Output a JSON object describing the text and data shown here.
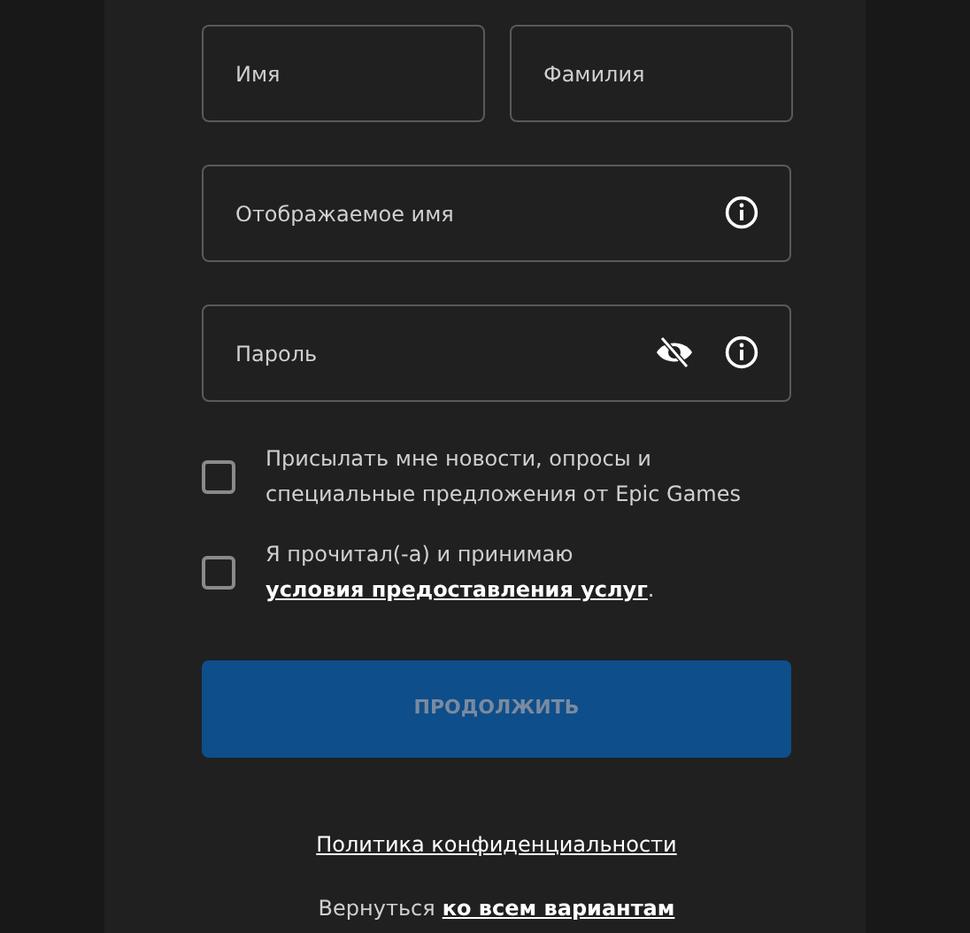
{
  "name_fields": [
    {
      "placeholder": "Имя"
    },
    {
      "placeholder": "Фамилия"
    }
  ],
  "fields": [
    {
      "placeholder": "Отображаемое имя",
      "password": false
    },
    {
      "placeholder": "Пароль",
      "password": true
    }
  ],
  "checkboxes": [
    {
      "checked": false,
      "text": "Присылать мне новости, опросы и специальные предложения от Epic Games"
    },
    {
      "checked": false,
      "text": "Я прочитал(-а) и принимаю",
      "link": "условия предоставления услуг",
      "after": "."
    }
  ],
  "continue_button": {
    "label": "ПРОДОЛЖИТЬ",
    "disabled": true
  },
  "privacy_link": "Политика конфиденциальности",
  "back": {
    "text": "Вернуться",
    "link": "ко всем вариантам"
  }
}
